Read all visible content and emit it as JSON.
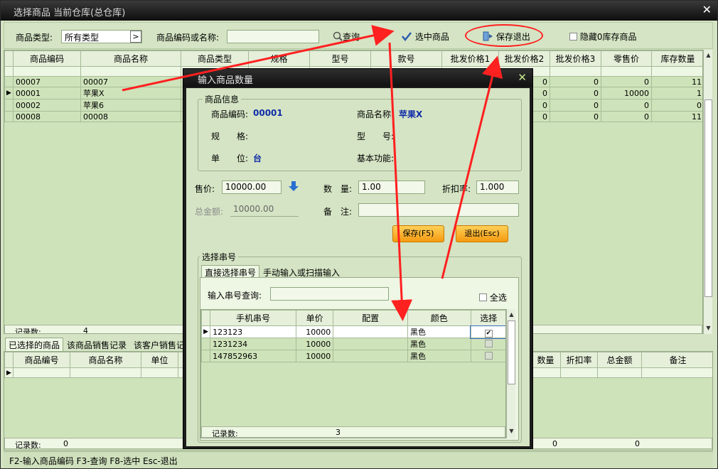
{
  "window": {
    "title": "选择商品 当前仓库(总仓库)"
  },
  "toolbar": {
    "type_label": "商品类型:",
    "type_value": "所有类型",
    "code_label": "商品编码或名称:",
    "code_value": "",
    "query_label": "查询",
    "select_label": "选中商品",
    "save_exit_label": "保存退出",
    "hide_zero_label": "隐藏0库存商品"
  },
  "product_grid": {
    "columns": [
      "商品编码",
      "商品名称",
      "商品类型",
      "规格",
      "型号",
      "款号",
      "批发价格1",
      "批发价格2",
      "批发价格3",
      "零售价",
      "库存数量"
    ],
    "rows": [
      {
        "code": "00007",
        "name": "00007",
        "wp2": "0",
        "wp3": "0",
        "retail": "0",
        "stock": "11"
      },
      {
        "code": "00001",
        "name": "苹果X",
        "wp2": "0",
        "wp3": "0",
        "retail": "10000",
        "stock": "1"
      },
      {
        "code": "00002",
        "name": "苹果6",
        "wp2": "0",
        "wp3": "0",
        "retail": "0",
        "stock": "0"
      },
      {
        "code": "00008",
        "name": "00008",
        "wp2": "0",
        "wp3": "0",
        "retail": "0",
        "stock": "11"
      }
    ],
    "record_label": "记录数:",
    "record_count": "4"
  },
  "lower_tabs": [
    "已选择的商品",
    "该商品销售记录",
    "该客户销售记"
  ],
  "selected_grid": {
    "columns": [
      "商品编号",
      "商品名称",
      "单位"
    ],
    "right_columns": [
      "数量",
      "折扣率",
      "总金额",
      "备注"
    ],
    "record_label": "记录数:",
    "record_count": "0",
    "footer_qty": "0",
    "footer_total": "0"
  },
  "status_bar": "F2-输入商品编码 F3-查询 F8-选中 Esc-退出",
  "dialog": {
    "title": "输入商品数量",
    "info_caption": "商品信息",
    "code_label": "商品编码:",
    "code_value": "00001",
    "name_label": "商品名称:",
    "name_value": "苹果X",
    "spec_label": "规　　格:",
    "model_label": "型　　号:",
    "unit_label": "单　　位:",
    "unit_value": "台",
    "func_label": "基本功能:",
    "price_label": "售价:",
    "price_value": "10000.00",
    "qty_label": "数　量:",
    "qty_value": "1.00",
    "discount_label": "折扣率:",
    "discount_value": "1.000",
    "total_label": "总金额:",
    "total_value": "10000.00",
    "remark_label": "备　注:",
    "remark_value": "",
    "save_label": "保存(F5)",
    "exit_label": "退出(Esc)",
    "serial_caption": "选择串号",
    "serial_tabs": [
      "直接选择串号",
      "手动输入或扫描输入"
    ],
    "serial_query_label": "输入串号查询:",
    "serial_query_value": "",
    "select_all_label": "全选",
    "serial_columns": [
      "手机串号",
      "单价",
      "配置",
      "颜色",
      "选择"
    ],
    "serial_rows": [
      {
        "serial": "123123",
        "price": "10000",
        "config": "",
        "color": "黑色",
        "checked": true
      },
      {
        "serial": "1231234",
        "price": "10000",
        "config": "",
        "color": "黑色",
        "checked": false
      },
      {
        "serial": "147852963",
        "price": "10000",
        "config": "",
        "color": "黑色",
        "checked": false
      }
    ],
    "serial_record_label": "记录数:",
    "serial_record_count": "3"
  },
  "colors": {
    "annotation": "#ff2020",
    "accent_blue": "#0f2ca8",
    "button_orange": "#f59a10",
    "panel_green": "#d5e4c4"
  }
}
